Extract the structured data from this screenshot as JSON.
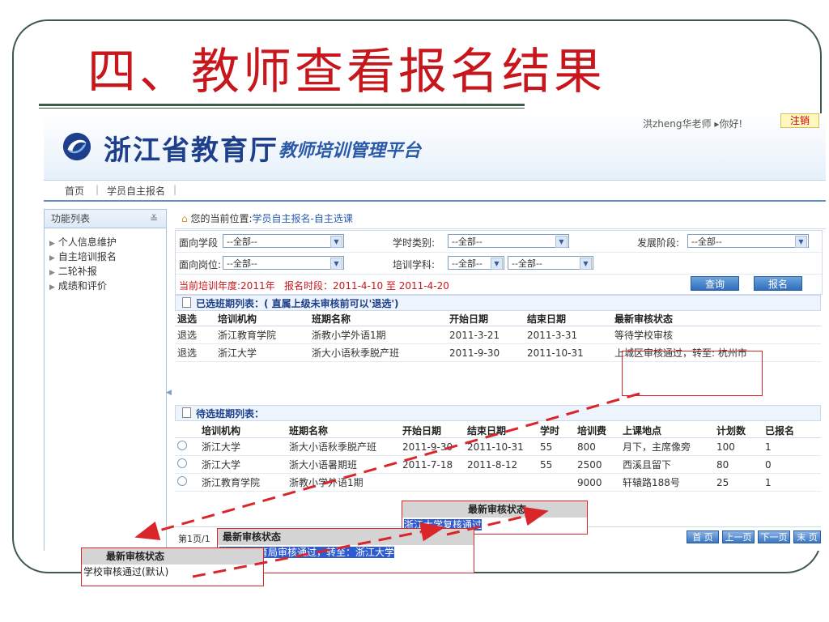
{
  "slide": {
    "title": "四、教师查看报名结果"
  },
  "header": {
    "brand": "浙江省教育厅",
    "platform": "教师培训管理平台",
    "user_greeting": "洪zheng华老师 ▸你好!",
    "logout": "注销"
  },
  "nav": {
    "items": [
      "首页",
      "学员自主报名"
    ]
  },
  "sidebar": {
    "title": "功能列表",
    "items": [
      "个人信息维护",
      "自主培训报名",
      "二轮补报",
      "成绩和评价"
    ]
  },
  "breadcrumb": {
    "prefix": "您的当前位置:",
    "location": "学员自主报名-自主选课"
  },
  "filters": {
    "stage_label": "面向学段",
    "stage_value": "--全部--",
    "hours_label": "学时类别:",
    "hours_value": "--全部--",
    "dev_label": "发展阶段:",
    "dev_value": "--全部--",
    "post_label": "面向岗位:",
    "post_value": "--全部--",
    "subject_label": "培训学科:",
    "subject_value1": "--全部--",
    "subject_value2": "--全部--",
    "year_info": "当前培训年度:2011年",
    "period_info": "报名时段：2011-4-10 至 2011-4-20",
    "query_button": "查询",
    "register_button": "报名"
  },
  "selected": {
    "title": "已选班期列表：( 直属上级未审核前可以'退选')",
    "headers": [
      "退选",
      "培训机构",
      "班期名称",
      "开始日期",
      "结束日期",
      "最新审核状态"
    ],
    "rows": [
      {
        "action": "退选",
        "org": "浙江教育学院",
        "name": "浙教小学外语1期",
        "start": "2011-3-21",
        "end": "2011-3-31",
        "status": "等待学校审核"
      },
      {
        "action": "退选",
        "org": "浙江大学",
        "name": "浙大小语秋季脱产班",
        "start": "2011-9-30",
        "end": "2011-10-31",
        "status": "上城区审核通过，转至: 杭州市"
      }
    ]
  },
  "pending": {
    "title": "待选班期列表：",
    "headers": [
      "",
      "培训机构",
      "班期名称",
      "开始日期",
      "结束日期",
      "学时",
      "培训费",
      "上课地点",
      "计划数",
      "已报名"
    ],
    "rows": [
      {
        "org": "浙江大学",
        "name": "浙大小语秋季脱产班",
        "start": "2011-9-30",
        "end": "2011-10-31",
        "hours": "55",
        "fee": "800",
        "place": "月下，主席像旁",
        "plan": "100",
        "enrolled": "1"
      },
      {
        "org": "浙江大学",
        "name": "浙大小语暑期班",
        "start": "2011-7-18",
        "end": "2011-8-12",
        "hours": "55",
        "fee": "2500",
        "place": "西溪且留下",
        "plan": "80",
        "enrolled": "0"
      },
      {
        "org": "浙江教育学院",
        "name": "浙教小学外语1期",
        "start": "",
        "end": "",
        "hours": "",
        "fee": "9000",
        "place": "轩辕路188号",
        "plan": "25",
        "enrolled": "1"
      }
    ]
  },
  "pager": {
    "info": "第1页/1",
    "first": "首 页",
    "prev": "上一页",
    "next": "下一页",
    "last": "末 页"
  },
  "callouts": {
    "header": "最新审核状态",
    "school": "学校审核通过(默认)",
    "city": "杭州市教育局审核通过，转至：浙江大学",
    "univ": "浙江大学复核通过"
  },
  "colors": {
    "title_red": "#c8161d",
    "brand_blue": "#1d3f8c",
    "callout_red": "#d9262b",
    "highlight": "#2f5bd0"
  }
}
